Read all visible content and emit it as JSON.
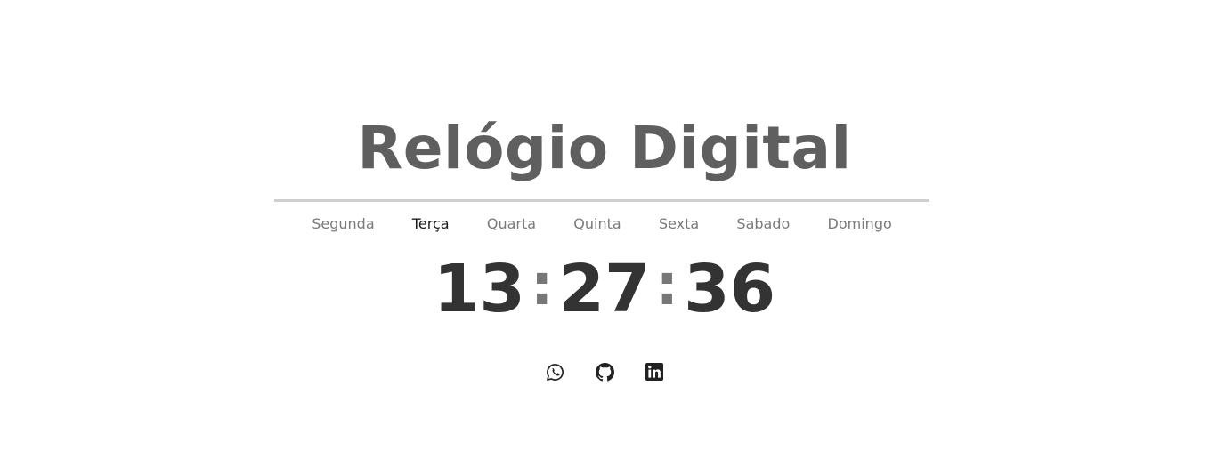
{
  "title": "Relógio Digital",
  "days": [
    {
      "label": "Segunda",
      "active": false
    },
    {
      "label": "Terça",
      "active": true
    },
    {
      "label": "Quarta",
      "active": false
    },
    {
      "label": "Quinta",
      "active": false
    },
    {
      "label": "Sexta",
      "active": false
    },
    {
      "label": "Sabado",
      "active": false
    },
    {
      "label": "Domingo",
      "active": false
    }
  ],
  "clock": {
    "hours": "13",
    "minutes": "27",
    "seconds": "36",
    "separator": ":"
  },
  "socials": [
    {
      "icon": "whatsapp-icon"
    },
    {
      "icon": "github-icon"
    },
    {
      "icon": "linkedin-icon"
    }
  ],
  "colors": {
    "title": "#5f5f5f",
    "active_day": "#1a1a1a",
    "inactive_day": "#7a7a7a",
    "clock": "#333333",
    "divider": "#cfcfcf"
  }
}
